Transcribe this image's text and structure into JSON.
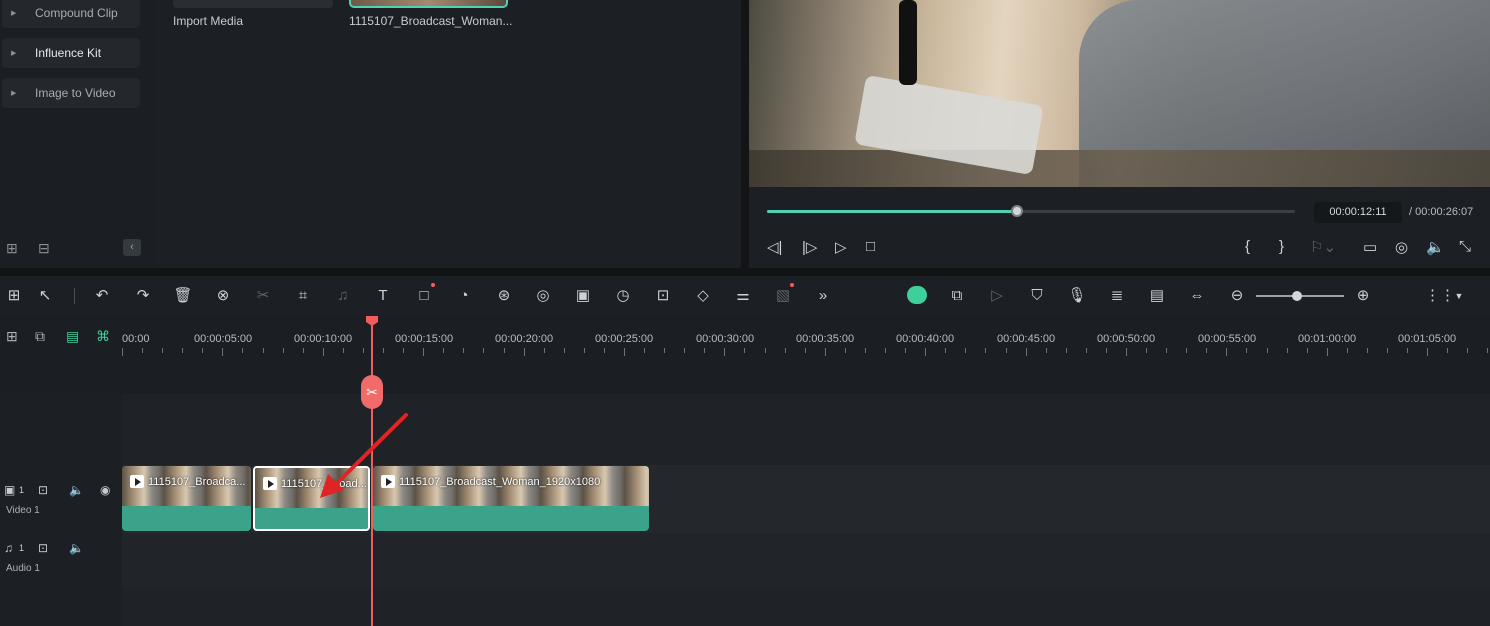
{
  "left_panel": {
    "items": [
      {
        "label": "Compound Clip"
      },
      {
        "label": "Influence Kit"
      },
      {
        "label": "Image to Video"
      }
    ]
  },
  "media": {
    "import_label": "Import Media",
    "clip_name": "1115107_Broadcast_Woman..."
  },
  "preview": {
    "current_time": "00:00:12:11",
    "total_time": "/ 00:00:26:07",
    "progress_fraction": 0.473
  },
  "timeline": {
    "ruler_labels": [
      "00:00",
      "00:00:05:00",
      "00:00:10:00",
      "00:00:15:00",
      "00:00:20:00",
      "00:00:25:00",
      "00:00:30:00",
      "00:00:35:00",
      "00:00:40:00",
      "00:00:45:00",
      "00:00:50:00",
      "00:00:55:00",
      "00:01:00:00",
      "00:01:05:00"
    ],
    "tracks": {
      "video_label": "Video 1",
      "video_num": "1",
      "audio_label": "Audio 1",
      "audio_num": "1"
    },
    "clips": [
      {
        "label": "1115107_Broadca..."
      },
      {
        "label": "1115107_Broad..."
      },
      {
        "label": "1115107_Broadcast_Woman_1920x1080"
      }
    ]
  },
  "accent_color": "#4fd1b5",
  "playhead_color": "#f25c5c",
  "clip_color": "#3aa38a"
}
